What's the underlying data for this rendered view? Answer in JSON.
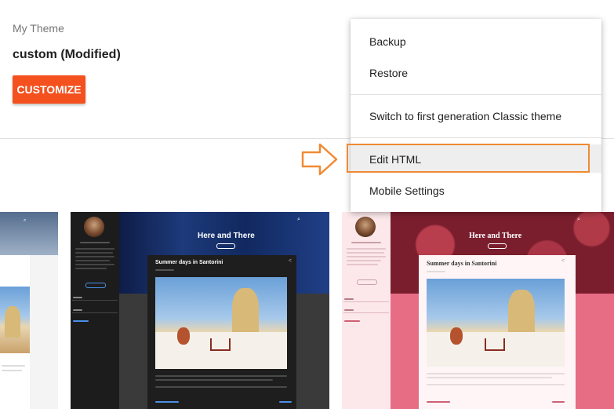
{
  "theme": {
    "section_label": "My Theme",
    "name": "custom (Modified)",
    "customize_label": "CUSTOMIZE"
  },
  "menu": {
    "items": [
      {
        "label": "Backup"
      },
      {
        "label": "Restore"
      },
      {
        "label": "Switch to first generation Classic theme"
      },
      {
        "label": "Edit HTML",
        "highlighted": true
      },
      {
        "label": "Mobile Settings"
      }
    ]
  },
  "gallery": {
    "dark": {
      "blog_title": "Here and There",
      "post_title": "Summer days in Santorini"
    },
    "red": {
      "blog_title": "Here and There",
      "post_title": "Summer days in Santorini"
    }
  },
  "colors": {
    "accent": "#f4511e",
    "annotation": "#f08a34"
  }
}
